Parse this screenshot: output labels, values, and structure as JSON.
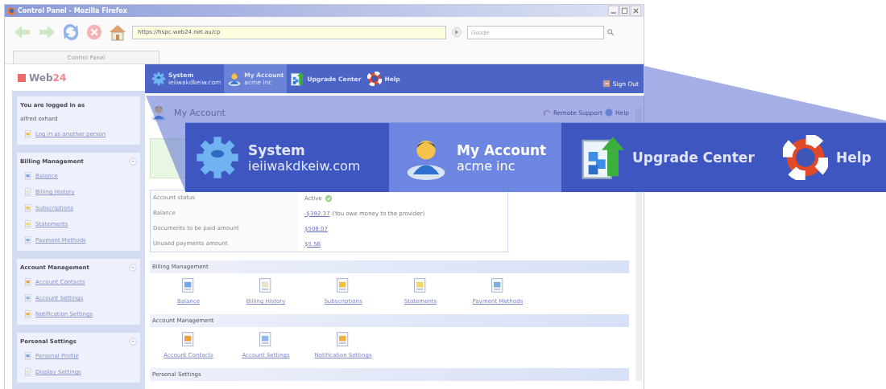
{
  "browser": {
    "title": "Control Panel - Mozilla Firefox",
    "url": "https://hspc.web24.net.au/cp",
    "search_placeholder": "Google",
    "tab": "Control Panel"
  },
  "sidebar": {
    "logo": [
      "Web",
      "24"
    ],
    "login": {
      "heading": "You are logged in as",
      "user": "alfred oxhard",
      "link": "Log in as another person"
    },
    "sections": [
      {
        "title": "Billing Management",
        "items": [
          "Balance",
          "Billing History",
          "Subscriptions",
          "Statements",
          "Payment Methods"
        ]
      },
      {
        "title": "Account Management",
        "items": [
          "Account Contacts",
          "Account Settings",
          "Notification Settings"
        ]
      },
      {
        "title": "Personal Settings",
        "items": [
          "Personal Profile",
          "Display Settings"
        ]
      }
    ]
  },
  "nav": {
    "items": [
      {
        "kind": "system",
        "title": "System",
        "subtitle": "ieiiwakdkeiw.com",
        "selected": false
      },
      {
        "kind": "account",
        "title": "My Account",
        "subtitle": "acme inc",
        "selected": true
      },
      {
        "kind": "upgrade",
        "title": "Upgrade Center",
        "selected": false
      },
      {
        "kind": "help",
        "title": "Help",
        "selected": false
      }
    ],
    "sign_out": "Sign Out"
  },
  "page": {
    "title": "My Account",
    "actions": [
      "Remote Support",
      "Help"
    ],
    "account_table": [
      {
        "label": "Account status",
        "value": "Active",
        "kind": "status"
      },
      {
        "label": "Balance",
        "value": "-$392.37",
        "note": "(You owe money to the provider)",
        "kind": "link"
      },
      {
        "label": "Documents to be paid amount",
        "value": "$508.07",
        "kind": "link"
      },
      {
        "label": "Unused payments amount",
        "value": "$5.56",
        "kind": "link"
      }
    ],
    "sections": [
      {
        "title": "Billing Management",
        "items": [
          "Balance",
          "Billing History",
          "Subscriptions",
          "Statements",
          "Payment Methods"
        ]
      },
      {
        "title": "Account Management",
        "items": [
          "Account Contacts",
          "Account Settings",
          "Notification Settings"
        ]
      },
      {
        "title": "Personal Settings"
      }
    ]
  },
  "callout": {
    "items": [
      {
        "kind": "system",
        "title": "System",
        "subtitle": "ieiiwakdkeiw.com",
        "selected": false
      },
      {
        "kind": "account",
        "title": "My Account",
        "subtitle": "acme inc",
        "selected": true
      },
      {
        "kind": "upgrade",
        "title": "Upgrade Center",
        "selected": false
      },
      {
        "kind": "help",
        "title": "Help",
        "selected": false
      }
    ]
  }
}
